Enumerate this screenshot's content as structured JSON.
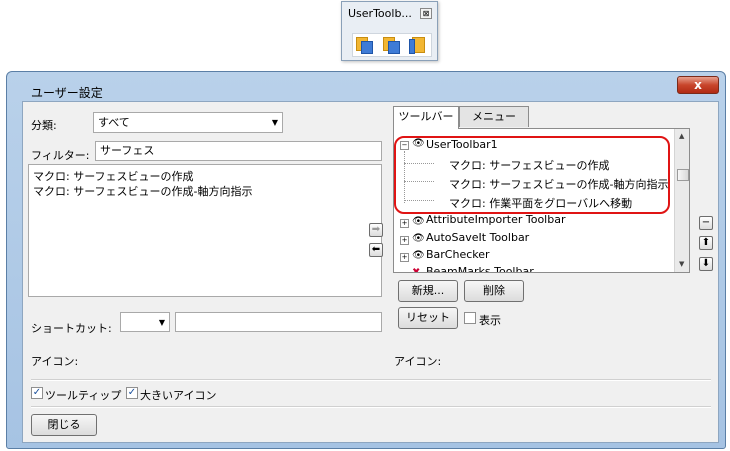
{
  "mini_toolbar": {
    "title": "UserToolb...",
    "close": "⊠"
  },
  "window": {
    "title": "ユーザー設定",
    "close": "x"
  },
  "left": {
    "category_label": "分類:",
    "category_value": "すべて",
    "filter_label": "フィルター:",
    "filter_value": "サーフェス",
    "list_items": [
      "マクロ: サーフェスビューの作成",
      "マクロ: サーフェスビューの作成-軸方向指示"
    ],
    "shortcut_label": "ショートカット:",
    "icon_label": "アイコン:"
  },
  "transfer": {
    "add": "➡",
    "remove": "⬅"
  },
  "right": {
    "tabs": [
      "ツールバー",
      "メニュー"
    ],
    "tree": {
      "toolbar1": "UserToolbar1",
      "children": [
        "マクロ: サーフェスビューの作成",
        "マクロ: サーフェスビューの作成-軸方向指示",
        "マクロ: 作業平面をグローバルへ移動"
      ],
      "others": [
        "AttributeImporter Toolbar",
        "AutoSaveIt Toolbar",
        "BarChecker",
        "BeamMarks Toolbar"
      ]
    },
    "side_buttons": [
      "−",
      "⬆",
      "⬇"
    ],
    "new_button": "新規...",
    "delete_button": "削除",
    "reset_button": "リセット",
    "show_label": "表示",
    "icon_label": "アイコン:"
  },
  "bottom": {
    "tooltip_label": "ツールティップ",
    "large_icon_label": "大きいアイコン",
    "close_button": "閉じる"
  },
  "colors": {
    "highlight": "#e01414",
    "title_bar": "#b9d1ea"
  }
}
